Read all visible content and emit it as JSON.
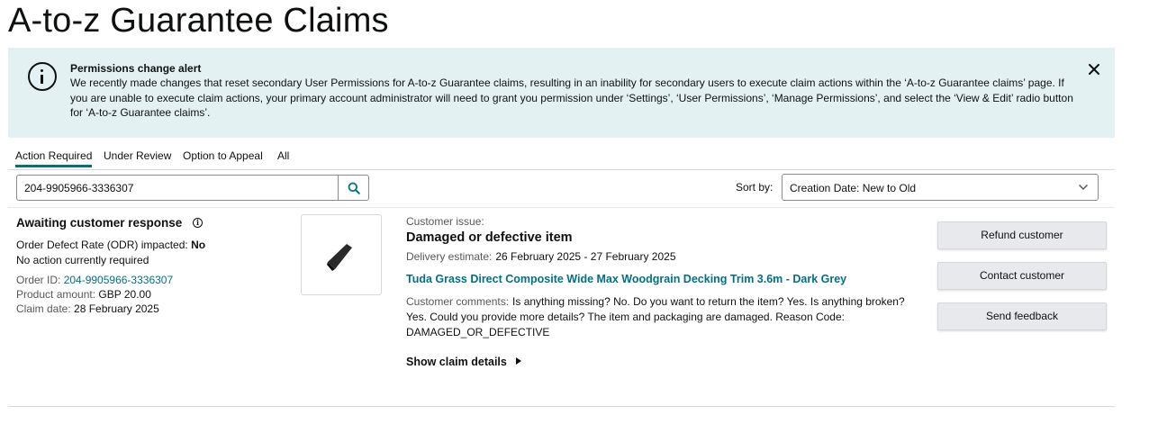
{
  "page": {
    "title": "A-to-z Guarantee Claims"
  },
  "alert": {
    "title": "Permissions change alert",
    "body": "We recently made changes that reset secondary User Permissions for A-to-z Guarantee claims, resulting in an inability for secondary users to execute claim actions within the ‘A-to-z Guarantee claims’ page. If you are unable to execute claim actions, your primary account administrator will need to grant you permission under ‘Settings’, ‘User Permissions’, ‘Manage Permissions’, and select the ‘View & Edit’ radio button for ‘A-to-z Guarantee claims’.",
    "icon": "info-circle-icon",
    "close_icon": "close-icon"
  },
  "tabs": [
    {
      "label": "Action Required",
      "active": true
    },
    {
      "label": "Under Review",
      "active": false
    },
    {
      "label": "Option to Appeal",
      "active": false
    },
    {
      "label": "All",
      "active": false
    }
  ],
  "search": {
    "value": "204-9905966-3336307",
    "icon": "search-icon"
  },
  "sort": {
    "label": "Sort by:",
    "selected": "Creation Date: New to Old"
  },
  "claim": {
    "status": "Awaiting customer response",
    "odr_label": "Order Defect Rate (ODR) impacted:",
    "odr_value": "No",
    "action_note": "No action currently required",
    "order_id_label": "Order ID:",
    "order_id": "204-9905966-3336307",
    "product_amount_label": "Product amount:",
    "product_amount": "GBP 20.00",
    "claim_date_label": "Claim date:",
    "claim_date": "28 February 2025",
    "issue_label": "Customer issue:",
    "issue": "Damaged or defective item",
    "delivery_label": "Delivery estimate:",
    "delivery_value": "26 February 2025 - 27 February 2025",
    "product_title": "Tuda Grass Direct Composite Wide Max Woodgrain Decking Trim 3.6m - Dark Grey",
    "comments_label": "Customer comments:",
    "comments": "Is anything missing? No. Do you want to return the item? Yes. Is anything broken? Yes. Could you provide more details? The item and packaging are damaged. Reason Code: DAMAGED_OR_DEFECTIVE",
    "show_details": "Show claim details"
  },
  "actions": {
    "refund": "Refund customer",
    "contact": "Contact customer",
    "feedback": "Send feedback"
  },
  "colors": {
    "accent": "#007185",
    "alert_bg": "#e3f1f3",
    "button_bg": "#e7e9ec"
  }
}
